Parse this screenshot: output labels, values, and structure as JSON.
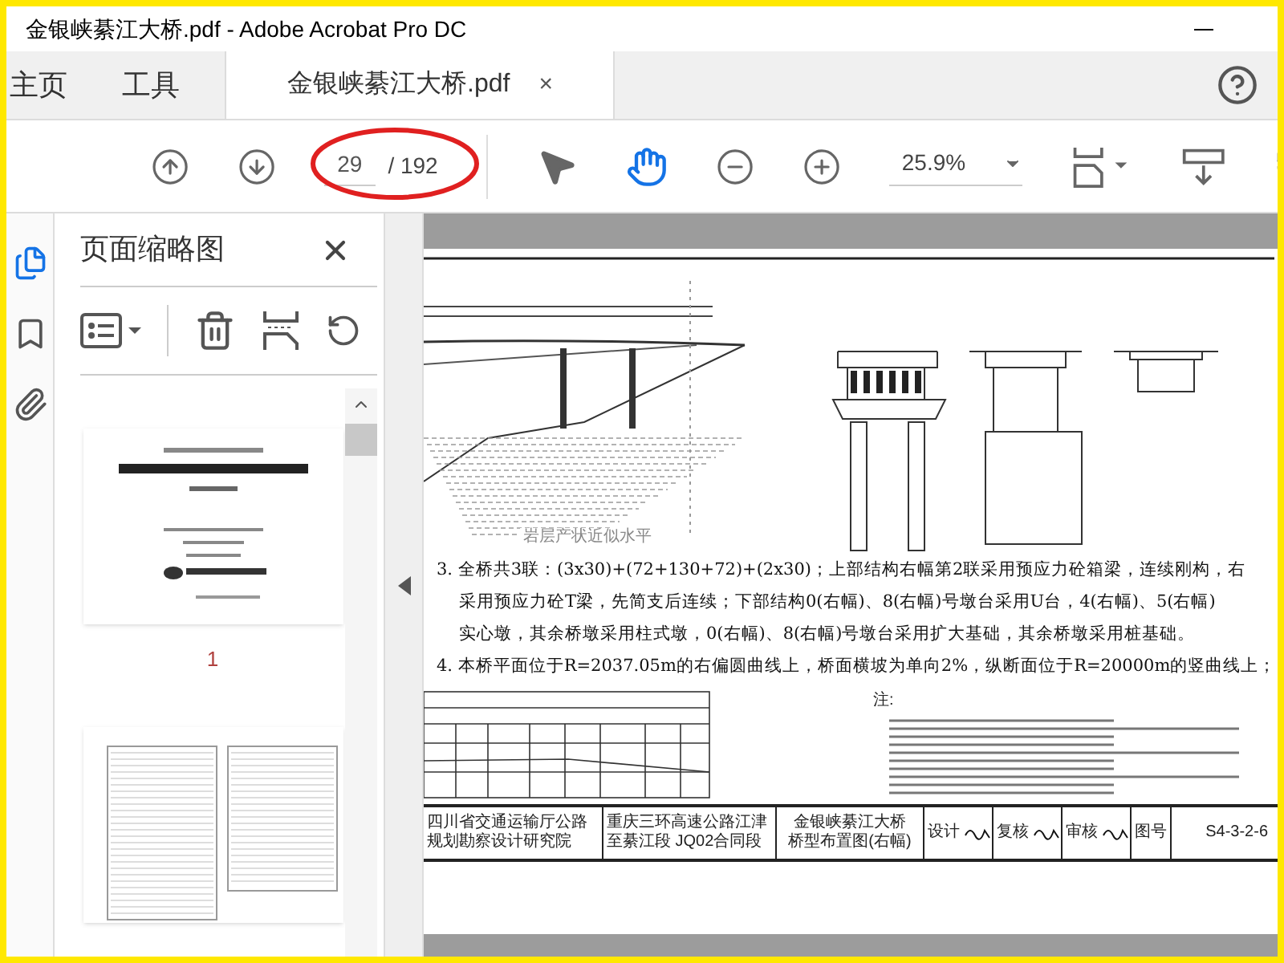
{
  "window": {
    "title": "金银峡綦江大桥.pdf - Adobe Acrobat Pro DC"
  },
  "nav_tabs": [
    {
      "label": "主页",
      "selected": false
    },
    {
      "label": "工具",
      "selected": false
    }
  ],
  "document_tab": {
    "label": "金银峡綦江大桥.pdf",
    "close": "×",
    "selected": true
  },
  "toolbar": {
    "page_number": "29",
    "page_count": "/ 192",
    "zoom": "25.9%",
    "tools": [
      {
        "kind": "select",
        "selected": false
      },
      {
        "kind": "hand",
        "selected": true
      }
    ]
  },
  "left_rail": [
    {
      "kind": "pages",
      "selected": true
    },
    {
      "kind": "bookmarks",
      "selected": false
    },
    {
      "kind": "attachments",
      "selected": false
    }
  ],
  "thumbnails_panel": {
    "title": "页面缩略图",
    "thumbnails": [
      {
        "kind": "cover",
        "label": "1"
      },
      {
        "kind": "contents"
      }
    ]
  },
  "page": {
    "drawing_caption": "岩层产状近似水平",
    "lines": [
      "3. 全桥共3联：(3x30)+(72+130+72)+(2x30)；上部结构右幅第2联采用预应力砼箱梁，连续刚构，右",
      "采用预应力砼T梁，先简支后连续；下部结构0(右幅)、8(右幅)号墩台采用U台，4(右幅)、5(右幅)",
      "实心墩，其余桥墩采用柱式墩，0(右幅)、8(右幅)号墩台采用扩大基础，其余桥墩采用桩基础。",
      "4. 本桥平面位于R=2037.05m的右偏圆曲线上，桥面横坡为单向2%，纵断面位于R=20000m的竖曲线上；"
    ],
    "notes_label": "注:",
    "title_block": {
      "institute": "四川省交通运输厅公路规划勘察设计研究院",
      "project": "重庆三环高速公路江津至綦江段 JQ02合同段",
      "drawing_title": [
        "金银峡綦江大桥",
        "桥型布置图(右幅)"
      ],
      "design": "设计",
      "check": "复核",
      "review": "审核",
      "number_label": "图号",
      "number": "S4-3-2-6"
    }
  }
}
